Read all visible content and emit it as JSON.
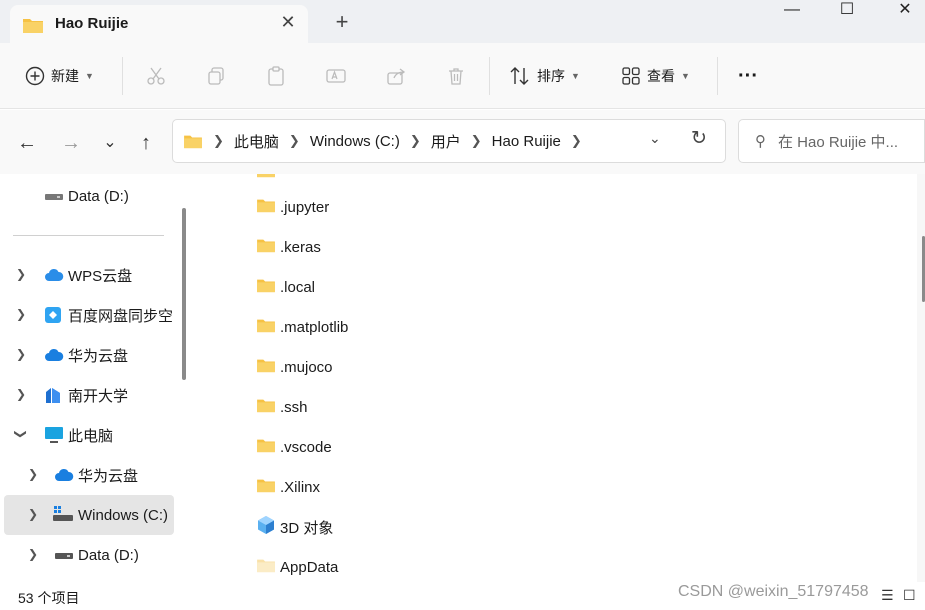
{
  "window": {
    "tab_title": "Hao Ruijie",
    "close_tab": "✕",
    "new_tab": "+",
    "minimize": "—",
    "maximize": "☐",
    "close": "✕"
  },
  "toolbar": {
    "new_label": "新建",
    "sort_label": "排序",
    "view_label": "查看",
    "more_label": "···"
  },
  "nav": {
    "back": "←",
    "forward": "→",
    "recent": "⌄",
    "up": "↑"
  },
  "address": {
    "crumbs": [
      "此电脑",
      "Windows (C:)",
      "用户",
      "Hao Ruijie"
    ]
  },
  "search": {
    "placeholder": "在 Hao Ruijie 中..."
  },
  "sidebar": {
    "items": [
      {
        "label": "Data (D:)",
        "icon": "drive-icon"
      },
      {
        "label": "WPS云盘",
        "icon": "cloud-icon"
      },
      {
        "label": "百度网盘同步空",
        "icon": "baidu-icon"
      },
      {
        "label": "华为云盘",
        "icon": "cloud-icon"
      },
      {
        "label": "南开大学",
        "icon": "onedrive-org-icon"
      },
      {
        "label": "此电脑",
        "icon": "pc-icon"
      },
      {
        "label": "华为云盘",
        "icon": "cloud-icon"
      },
      {
        "label": "Windows (C:)",
        "icon": "windows-drive-icon"
      },
      {
        "label": "Data (D:)",
        "icon": "drive-icon"
      }
    ]
  },
  "files": [
    {
      "name": ".jupyter",
      "icon": "folder-icon"
    },
    {
      "name": ".keras",
      "icon": "folder-icon"
    },
    {
      "name": ".local",
      "icon": "folder-icon"
    },
    {
      "name": ".matplotlib",
      "icon": "folder-icon"
    },
    {
      "name": ".mujoco",
      "icon": "folder-icon"
    },
    {
      "name": ".ssh",
      "icon": "folder-icon"
    },
    {
      "name": ".vscode",
      "icon": "folder-icon"
    },
    {
      "name": ".Xilinx",
      "icon": "folder-icon"
    },
    {
      "name": "3D 对象",
      "icon": "3d-objects-icon"
    },
    {
      "name": "AppData",
      "icon": "folder-hidden-icon"
    }
  ],
  "status": {
    "count": "53 个项目",
    "watermark": "CSDN @weixin_51797458"
  },
  "colors": {
    "folder": "#f6c244",
    "accent": "#0067c0",
    "selected_bg": "#e5e5e5"
  }
}
